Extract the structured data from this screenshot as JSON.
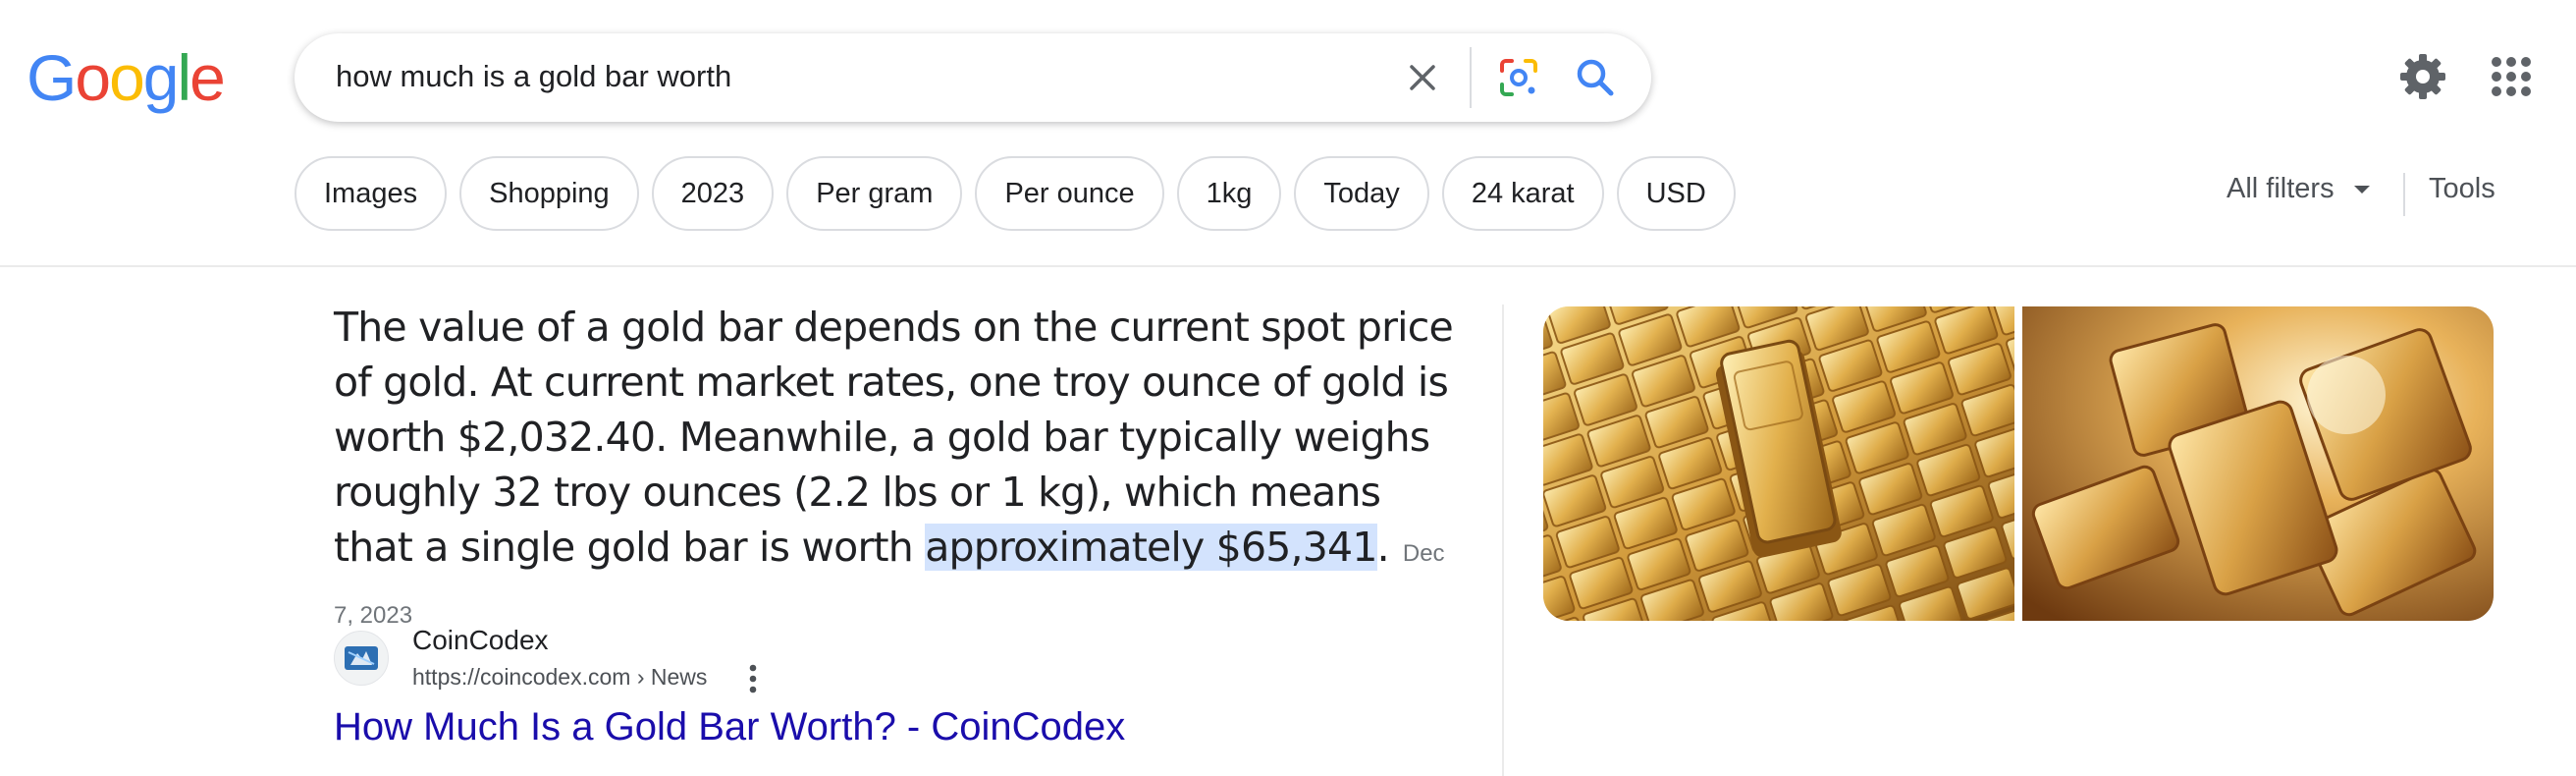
{
  "logo": {
    "letters": [
      "G",
      "o",
      "o",
      "g",
      "l",
      "e"
    ],
    "colors": [
      "#4285F4",
      "#EA4335",
      "#FBBC05",
      "#4285F4",
      "#34A853",
      "#EA4335"
    ]
  },
  "search": {
    "query": "how much is a gold bar worth"
  },
  "icons": {
    "clear": "close-icon",
    "lens": "google-lens-icon",
    "search": "search-icon",
    "settings": "gear-icon",
    "apps": "apps-grid-icon"
  },
  "chips": [
    "Images",
    "Shopping",
    "2023",
    "Per gram",
    "Per ounce",
    "1kg",
    "Today",
    "24 karat",
    "USD"
  ],
  "filters": {
    "all_filters": "All filters",
    "tools": "Tools"
  },
  "snippet": {
    "text_before": "The value of a gold bar depends on the current spot price of gold. At current market rates, one troy ounce of gold is worth $2,032.40. Meanwhile, a gold bar typically weighs roughly 32 troy ounces (2.2 lbs or 1 kg), which means that a single gold bar is worth ",
    "highlight": "approximately $65,341",
    "text_after": ".",
    "date": "Dec 7, 2023"
  },
  "source": {
    "name": "CoinCodex",
    "url": "https://coincodex.com › News",
    "title": "How Much Is a Gold Bar Worth? - CoinCodex"
  },
  "colors": {
    "link": "#1a0dab",
    "highlight": "#d3e3fd",
    "gold": "#d9a441"
  }
}
